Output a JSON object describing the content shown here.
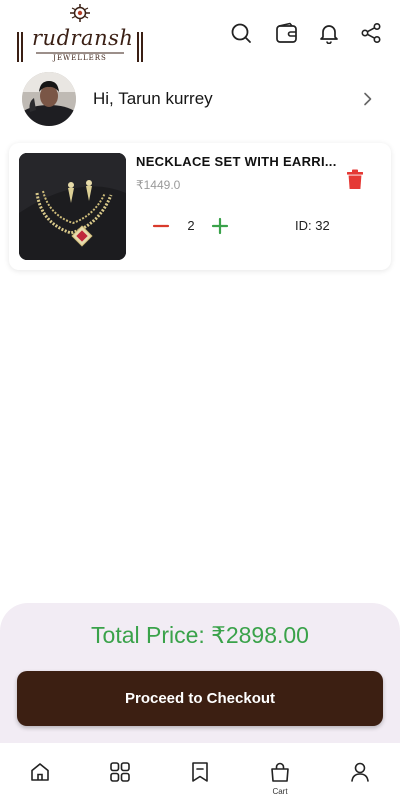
{
  "brand": {
    "name": "rudransh",
    "tagline": "JEWELLERS"
  },
  "greeting": {
    "text": "Hi, Tarun kurrey"
  },
  "cart": {
    "items": [
      {
        "name": "NECKLACE SET WITH EARRI...",
        "price": "₹1449.0",
        "quantity": "2",
        "id_label": "ID: 32"
      }
    ]
  },
  "summary": {
    "total_price": "Total Price: ₹2898.00",
    "checkout_label": "Proceed to Checkout"
  },
  "nav": {
    "items": [
      {
        "icon": "home-icon",
        "label": ""
      },
      {
        "icon": "grid-icon",
        "label": ""
      },
      {
        "icon": "bookmark-icon",
        "label": ""
      },
      {
        "icon": "bag-icon",
        "label": "Cart"
      },
      {
        "icon": "user-icon",
        "label": ""
      }
    ]
  },
  "colors": {
    "primary": "#3c1f12",
    "total_green": "#3aa24a",
    "delete_red": "#e53935",
    "sheet_bg": "#f2ecf4"
  }
}
